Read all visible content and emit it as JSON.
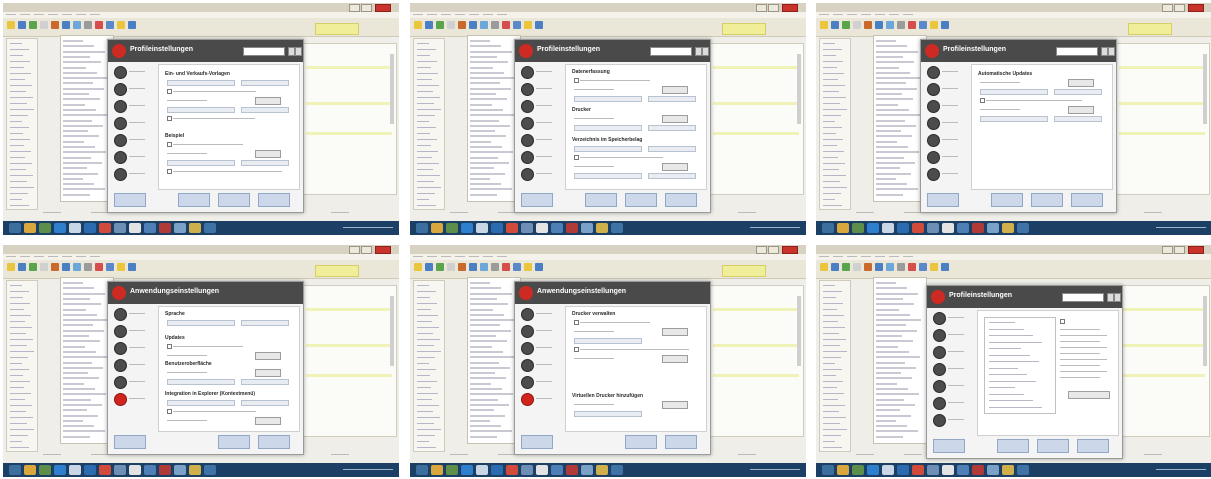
{
  "tiles": [
    {
      "dialog_title": "Profileinstellungen",
      "section1": "Ein- und Verkaufs-Vorlagen",
      "section2": "Beispiel"
    },
    {
      "dialog_title": "Profileinstellungen",
      "section1": "Datenerfassung",
      "section2": "Drucker",
      "section3": "Verzeichnis im Speicherbelag"
    },
    {
      "dialog_title": "Profileinstellungen",
      "section1": "Automatische Updates"
    },
    {
      "dialog_title": "Anwendungseinstellungen",
      "section1": "Sprache",
      "section2": "Updates",
      "section3": "Benutzeroberfläche",
      "section4": "Integration in Explorer (Kontextmenü)"
    },
    {
      "dialog_title": "Anwendungseinstellungen",
      "section1": "Drucker verwalten",
      "section2": "Virtuellen Drucker hinzufügen"
    },
    {
      "dialog_title": "Profileinstellungen"
    }
  ],
  "colors": {
    "desktop": "#efeee8",
    "dialog_header": "#4a4a4a",
    "accent_red": "#cc2a22",
    "taskbar": "#1c3f66",
    "highlight_yellow": "#f1ee9a"
  },
  "icons": [
    "app-logo-icon",
    "nav-circle-icon",
    "close-icon",
    "taskbar-app-icon"
  ]
}
